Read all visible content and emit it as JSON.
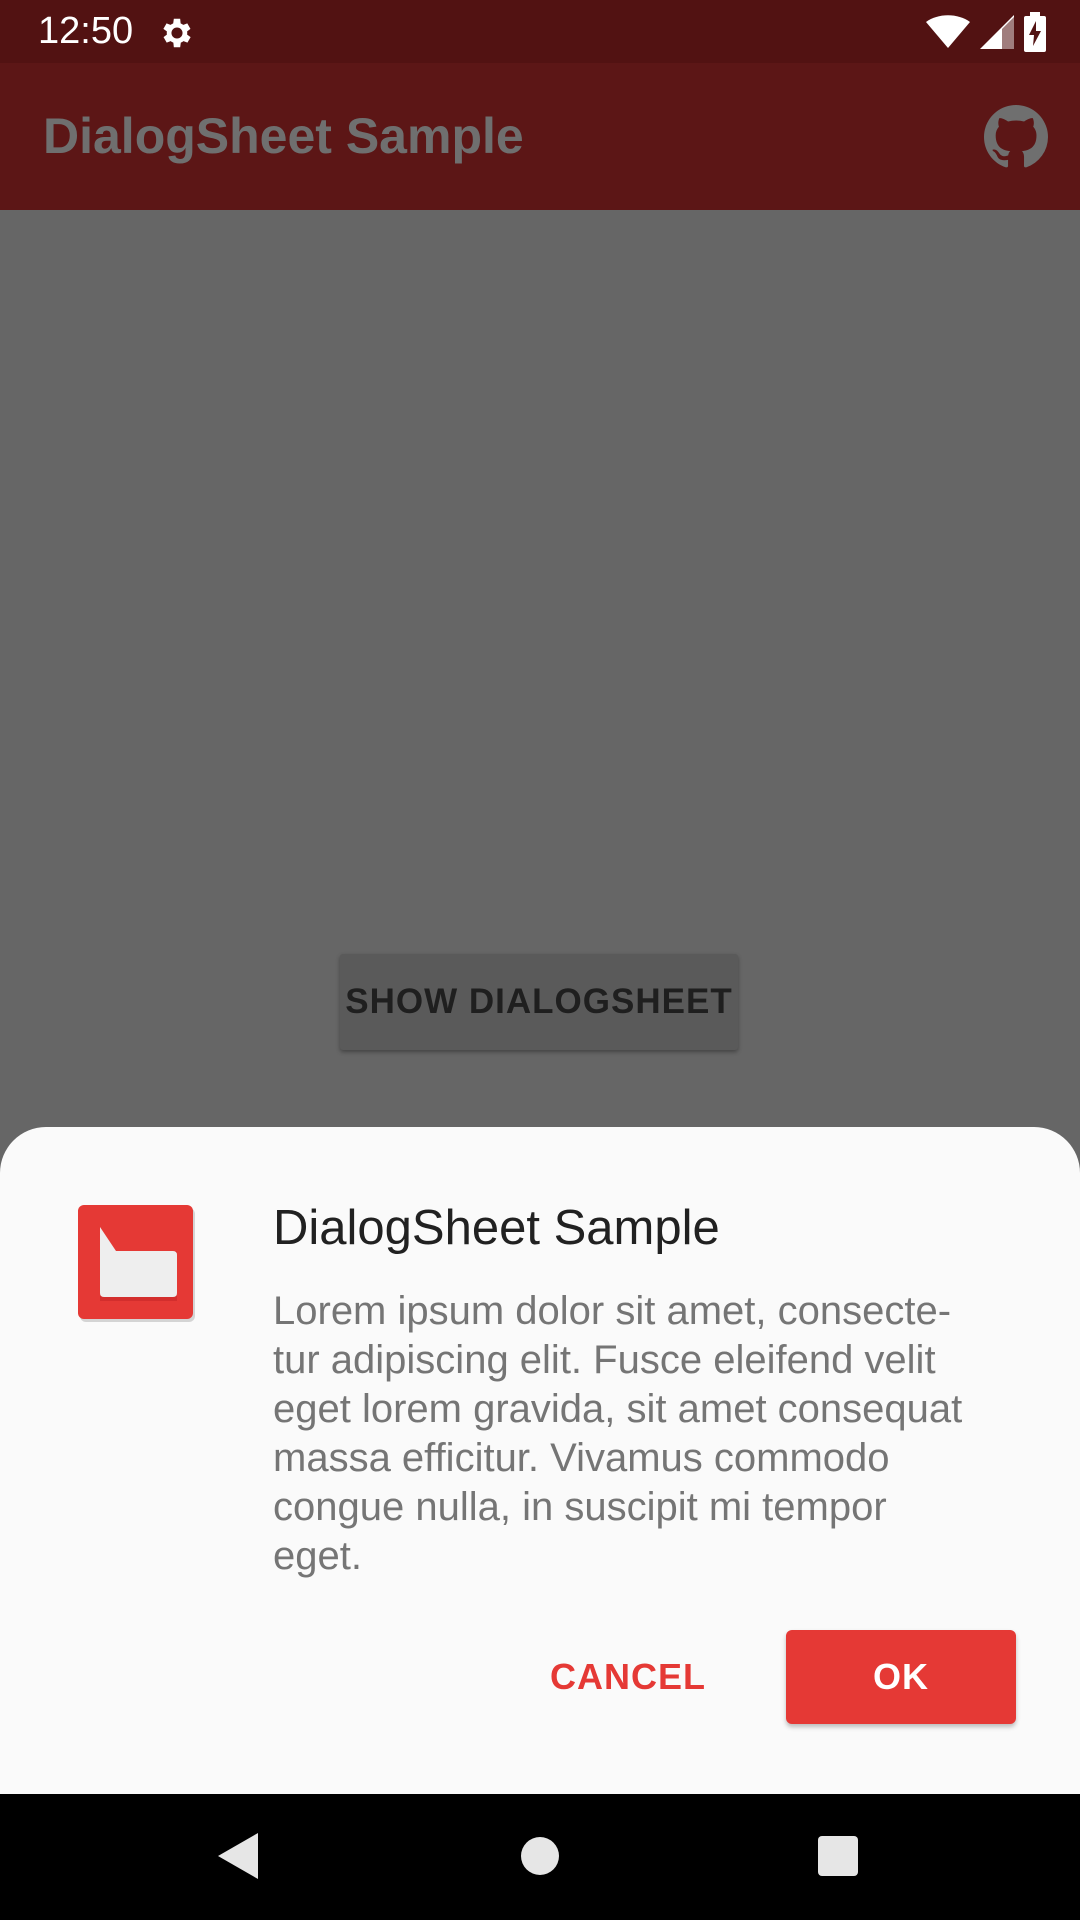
{
  "status_bar": {
    "time": "12:50",
    "icons": [
      "settings-icon",
      "wifi-icon",
      "signal-icon",
      "battery-charging-icon"
    ]
  },
  "app_bar": {
    "title": "DialogSheet Sample",
    "action_icon": "github-icon"
  },
  "content": {
    "show_button_label": "SHOW DIALOGSHEET"
  },
  "dialog": {
    "icon": "app-logo-icon",
    "title": "DialogSheet Sample",
    "message": "Lorem ipsum dolor sit amet, consecte-\ntur adipiscing elit. Fusce eleifend velit\neget lorem gravida, sit amet consequat\nmassa efficitur. Vivamus commodo\ncongue nulla, in suscipit mi tempor\neget.",
    "negative_label": "CANCEL",
    "positive_label": "OK"
  },
  "nav_bar": {
    "icons": [
      "back-icon",
      "home-icon",
      "recents-icon"
    ]
  },
  "colors": {
    "status_bar": "#521212",
    "app_bar": "#5c1616",
    "scrim": "#666666",
    "accent": "#e53935",
    "sheet_background": "#fafafa"
  }
}
